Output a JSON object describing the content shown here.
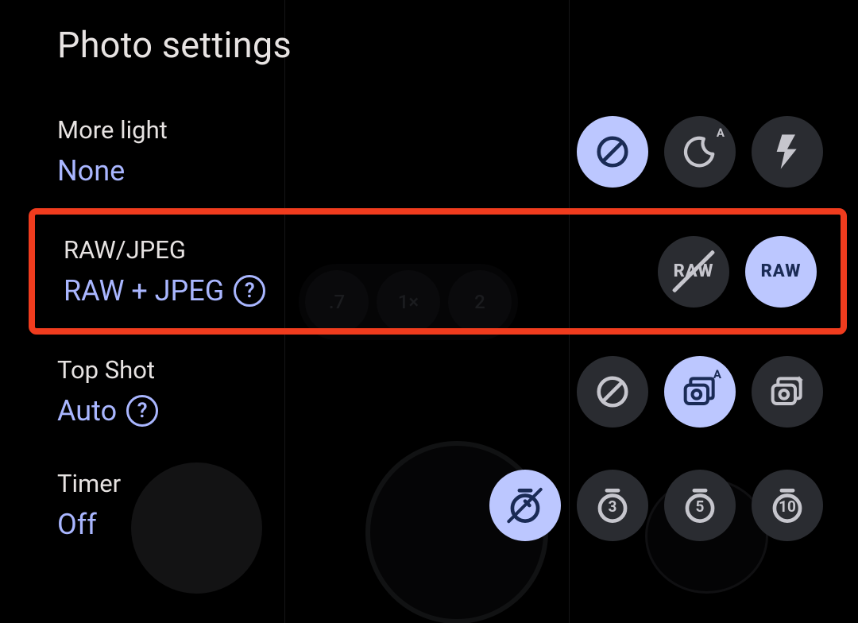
{
  "title": "Photo settings",
  "settings": {
    "more_light": {
      "label": "More light",
      "value": "None"
    },
    "raw_jpeg": {
      "label": "RAW/JPEG",
      "value": "RAW + JPEG"
    },
    "top_shot": {
      "label": "Top Shot",
      "value": "Auto"
    },
    "timer": {
      "label": "Timer",
      "value": "Off"
    }
  },
  "zoom_levels": {
    "a": ".7",
    "b": "1×",
    "c": "2"
  },
  "raw_label": "RAW",
  "timer_values": {
    "t3": "3",
    "t5": "5",
    "t10": "10"
  },
  "auto_badge": "A",
  "help_glyph": "?"
}
